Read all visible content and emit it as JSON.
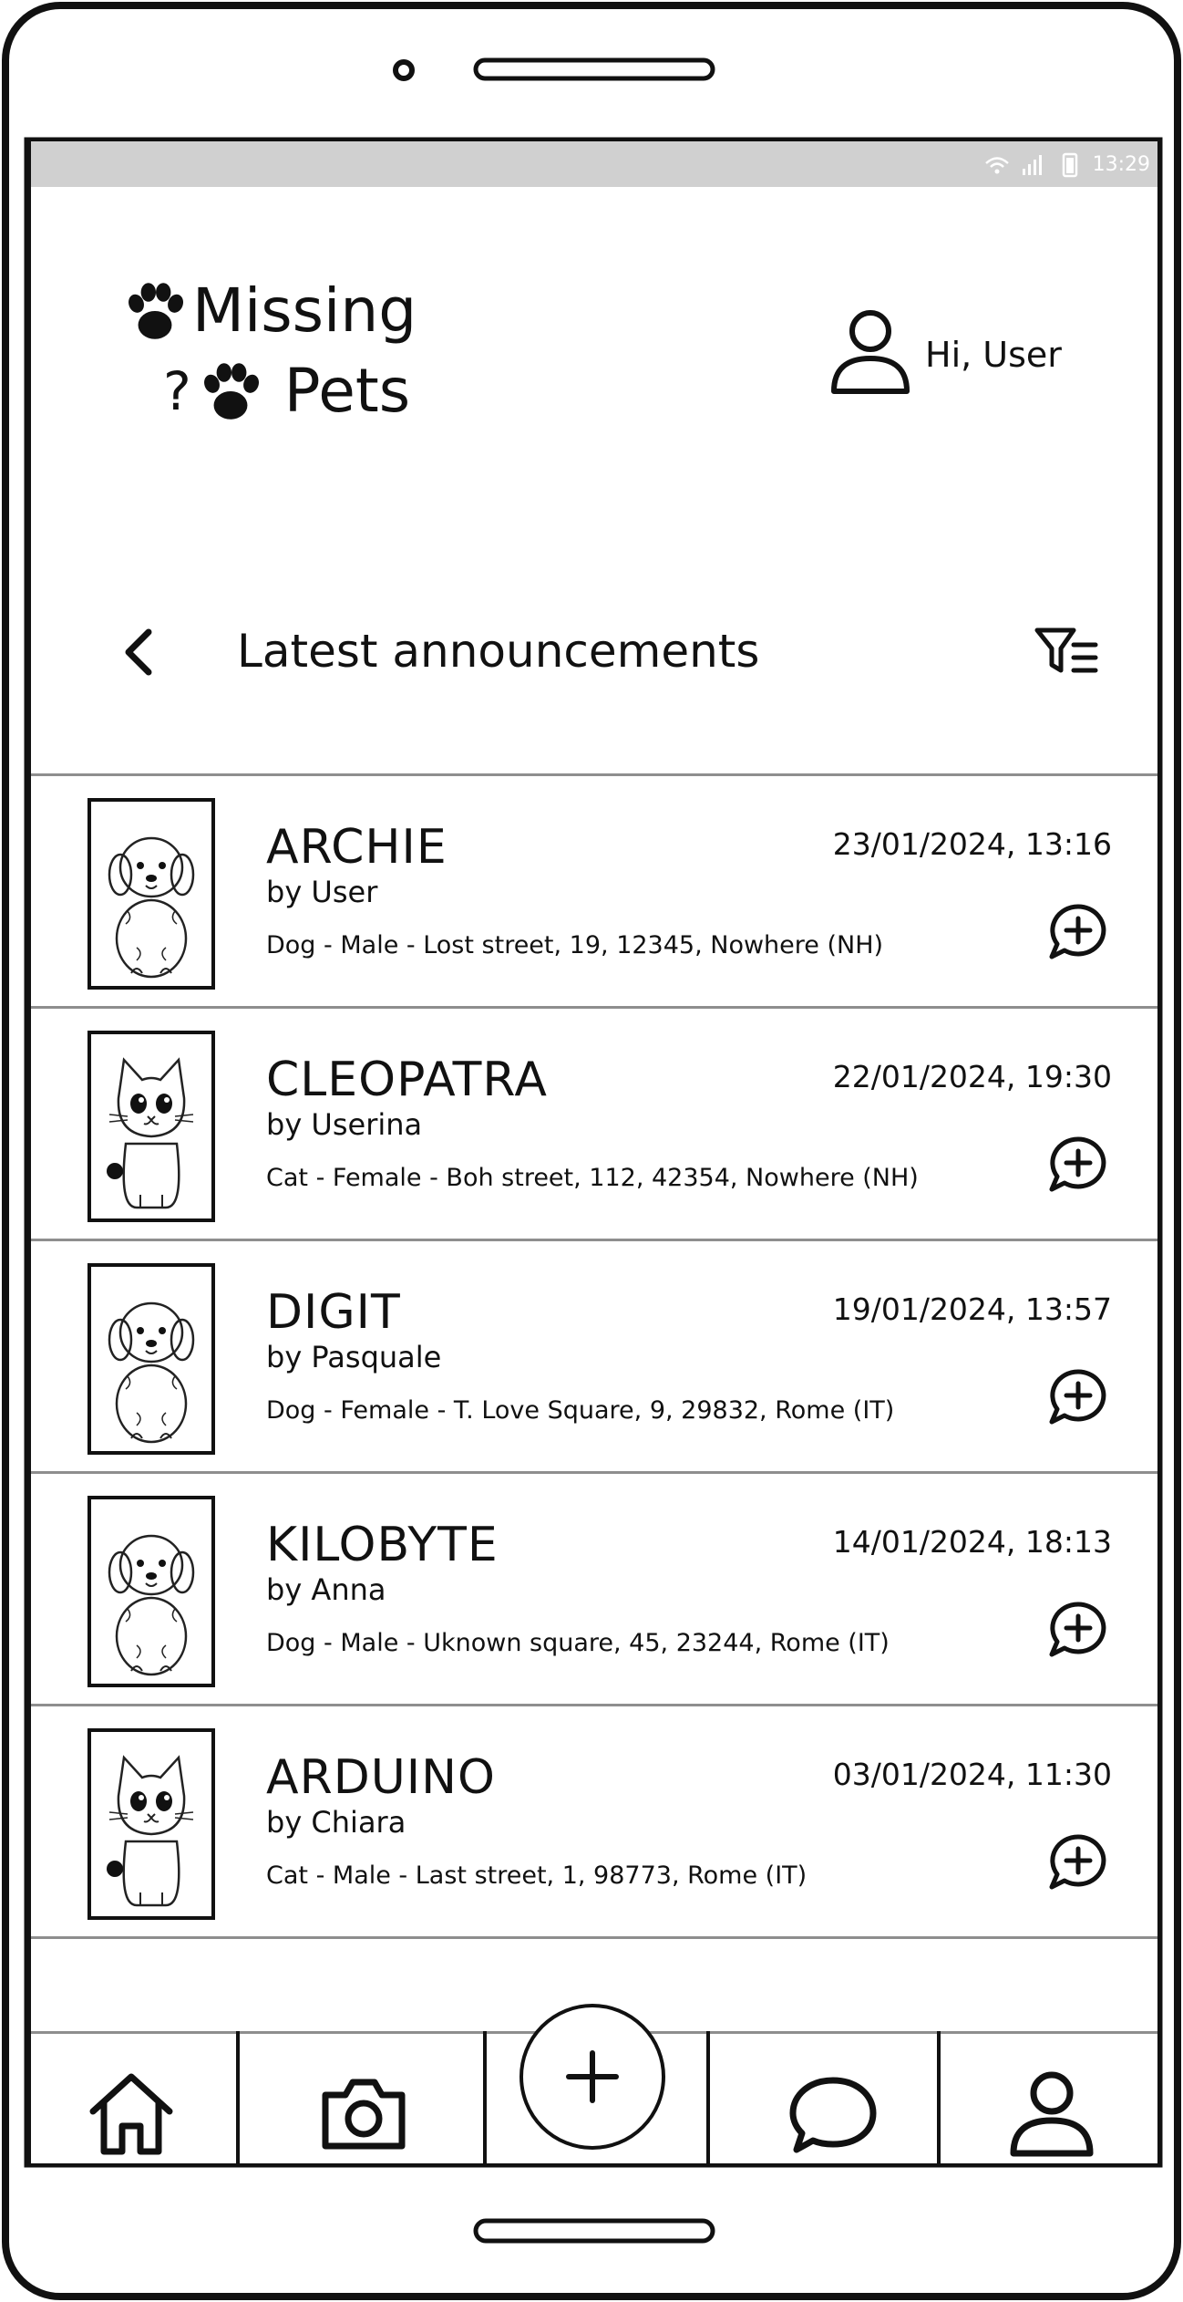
{
  "status_bar": {
    "time": "13:29"
  },
  "logo": {
    "line1": "Missing",
    "line2_prefix": "?",
    "line2": "Pets"
  },
  "user": {
    "greeting": "Hi, User"
  },
  "page": {
    "title": "Latest announcements"
  },
  "announcements": [
    {
      "name": "ARCHIE",
      "by": "by User",
      "datetime": "23/01/2024, 13:16",
      "details": "Dog - Male - Lost street, 19, 12345, Nowhere (NH)",
      "species": "dog"
    },
    {
      "name": "CLEOPATRA",
      "by": "by Userina",
      "datetime": "22/01/2024, 19:30",
      "details": "Cat - Female - Boh street, 112, 42354, Nowhere (NH)",
      "species": "cat"
    },
    {
      "name": "DIGIT",
      "by": "by Pasquale",
      "datetime": "19/01/2024, 13:57",
      "details": "Dog - Female - T. Love Square, 9, 29832, Rome (IT)",
      "species": "dog"
    },
    {
      "name": "KILOBYTE",
      "by": "by Anna",
      "datetime": "14/01/2024, 18:13",
      "details": "Dog - Male - Uknown square, 45, 23244, Rome (IT)",
      "species": "dog"
    },
    {
      "name": "ARDUINO",
      "by": "by Chiara",
      "datetime": "03/01/2024, 11:30",
      "details": "Cat - Male - Last street, 1, 98773, Rome (IT)",
      "species": "cat"
    }
  ],
  "tab_bar": {
    "items": [
      "home-icon",
      "camera-icon",
      "plus-icon",
      "chat-icon",
      "profile-icon"
    ]
  }
}
